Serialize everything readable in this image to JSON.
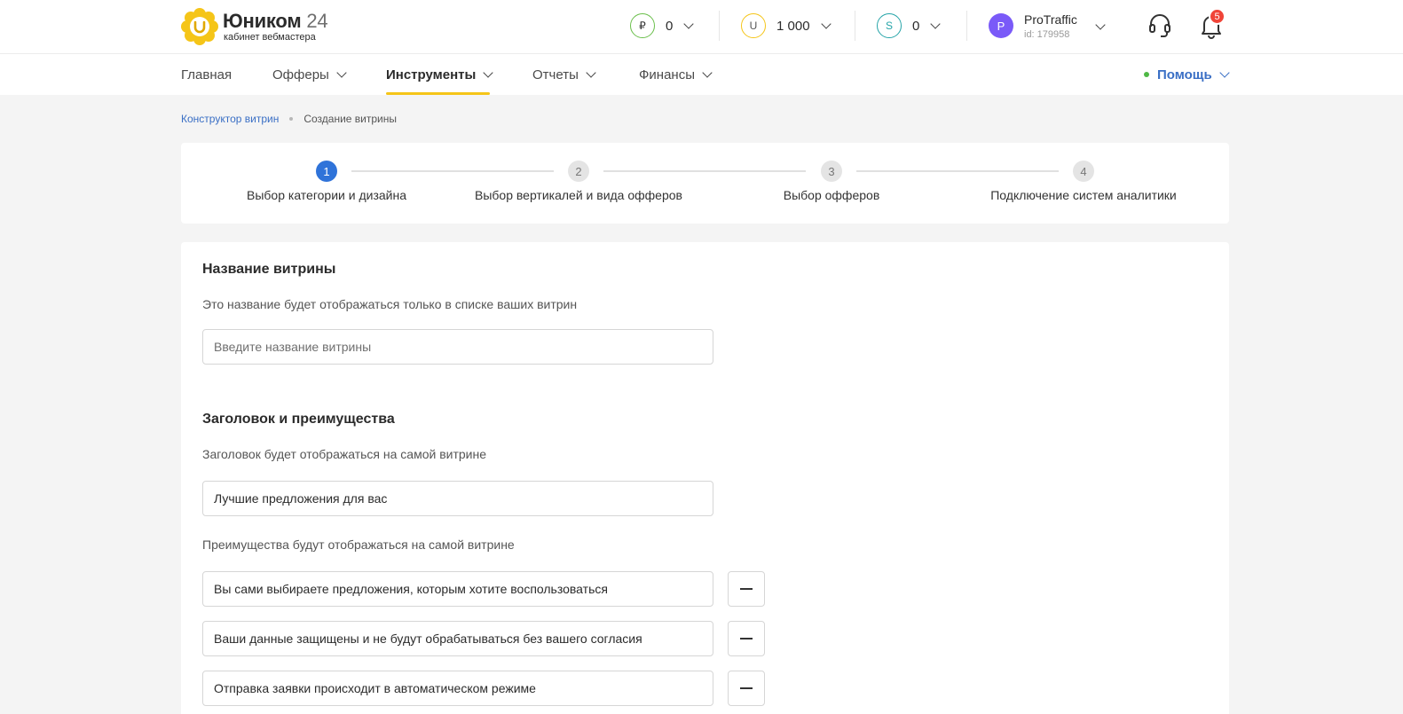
{
  "header": {
    "logo": {
      "name": "Юником",
      "number": "24",
      "subtitle": "кабинет вебмастера"
    },
    "balances": [
      {
        "symbol": "₽",
        "value": "0",
        "color": "#6abf4b"
      },
      {
        "symbol": "U",
        "value": "1 000",
        "color": "#f5c518"
      },
      {
        "symbol": "S",
        "value": "0",
        "color": "#25a4a8"
      }
    ],
    "user": {
      "initial": "P",
      "name": "ProTraffic",
      "id": "id: 179958"
    },
    "notifications_count": "5"
  },
  "nav": {
    "items": [
      {
        "label": "Главная"
      },
      {
        "label": "Офферы"
      },
      {
        "label": "Инструменты"
      },
      {
        "label": "Отчеты"
      },
      {
        "label": "Финансы"
      }
    ],
    "active": "Инструменты",
    "help_label": "Помощь"
  },
  "breadcrumb": {
    "parent": "Конструктор витрин",
    "current": "Создание витрины"
  },
  "stepper": {
    "steps": [
      {
        "number": "1",
        "label": "Выбор категории и дизайна"
      },
      {
        "number": "2",
        "label": "Выбор вертикалей и вида офферов"
      },
      {
        "number": "3",
        "label": "Выбор офферов"
      },
      {
        "number": "4",
        "label": "Подключение систем аналитики"
      }
    ],
    "current_step": 1
  },
  "form": {
    "name_section": {
      "title": "Название витрины",
      "hint": "Это название будет отображаться только в списке ваших витрин",
      "placeholder": "Введите название витрины",
      "value": ""
    },
    "heading_section": {
      "title": "Заголовок и преимущества",
      "hint": "Заголовок будет отображаться на самой витрине",
      "value": "Лучшие предложения для вас",
      "benefits_hint": "Преимущества будут отображаться на самой витрине",
      "benefits": [
        "Вы сами выбираете предложения, которым хотите воспользоваться",
        "Ваши данные защищены и не будут обрабатываться без вашего согласия",
        "Отправка заявки происходит в автоматическом режиме"
      ]
    }
  }
}
